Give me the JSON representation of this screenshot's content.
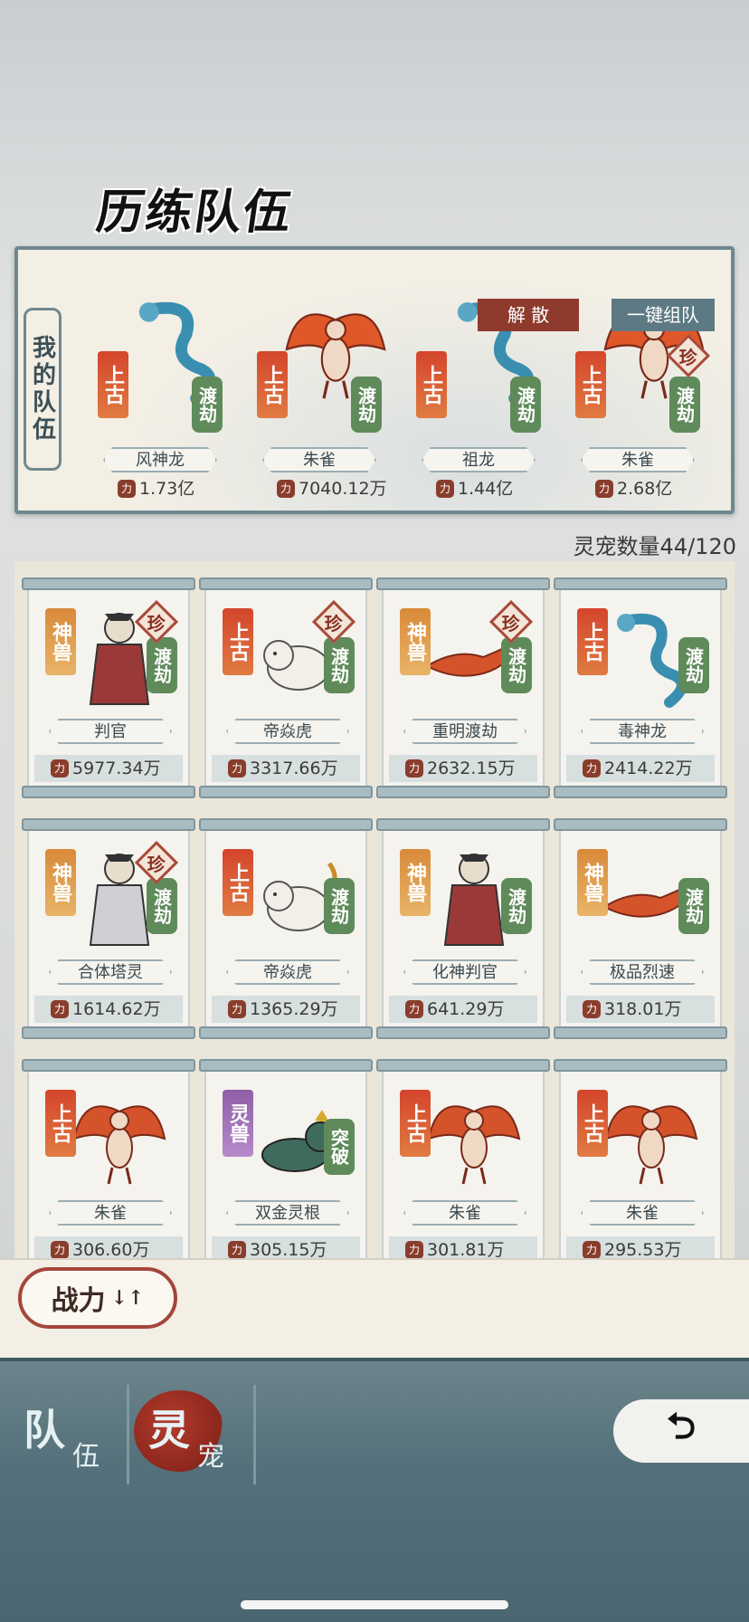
{
  "title": "历练队伍",
  "team_panel": {
    "label": "我的队伍",
    "disband_label": "解 散",
    "one_click_label": "一键组队",
    "members": [
      {
        "name": "风神龙",
        "rank": "上古",
        "stage": "渡劫",
        "rare": "",
        "power": "1.73亿",
        "color": "#3f7a3a"
      },
      {
        "name": "朱雀",
        "rank": "上古",
        "stage": "渡劫",
        "rare": "",
        "power": "7040.12万",
        "color": "#e0572a"
      },
      {
        "name": "祖龙",
        "rank": "上古",
        "stage": "渡劫",
        "rare": "",
        "power": "1.44亿",
        "color": "#3a8fb0"
      },
      {
        "name": "朱雀",
        "rank": "上古",
        "stage": "渡劫",
        "rare": "珍",
        "power": "2.68亿",
        "color": "#e0572a"
      }
    ]
  },
  "pet_count": "灵宠数量44/120",
  "pets": [
    {
      "name": "判官",
      "rank": "神兽",
      "rank_color": "orange",
      "stage": "渡劫",
      "rare": "珍",
      "power": "5977.34万",
      "art": "judge"
    },
    {
      "name": "帝焱虎",
      "rank": "上古",
      "rank_color": "red",
      "stage": "渡劫",
      "rare": "珍",
      "power": "3317.66万",
      "art": "tiger"
    },
    {
      "name": "重明渡劫",
      "rank": "神兽",
      "rank_color": "orange",
      "stage": "渡劫",
      "rare": "珍",
      "power": "2632.15万",
      "art": "bird"
    },
    {
      "name": "毒神龙",
      "rank": "上古",
      "rank_color": "red",
      "stage": "渡劫",
      "rare": "",
      "power": "2414.22万",
      "art": "dragon"
    },
    {
      "name": "合体塔灵",
      "rank": "神兽",
      "rank_color": "orange",
      "stage": "渡劫",
      "rare": "珍",
      "power": "1614.62万",
      "art": "spirit"
    },
    {
      "name": "帝焱虎",
      "rank": "上古",
      "rank_color": "red",
      "stage": "渡劫",
      "rare": "",
      "power": "1365.29万",
      "art": "tiger"
    },
    {
      "name": "化神判官",
      "rank": "神兽",
      "rank_color": "orange",
      "stage": "渡劫",
      "rare": "",
      "power": "641.29万",
      "art": "judge"
    },
    {
      "name": "极品烈速",
      "rank": "神兽",
      "rank_color": "orange",
      "stage": "渡劫",
      "rare": "",
      "power": "318.01万",
      "art": "bird"
    },
    {
      "name": "朱雀",
      "rank": "上古",
      "rank_color": "red",
      "stage": "",
      "rare": "",
      "power": "306.60万",
      "art": "phoenix"
    },
    {
      "name": "双金灵根",
      "rank": "灵兽",
      "rank_color": "purple",
      "stage": "突破",
      "rare": "",
      "power": "305.15万",
      "art": "beast"
    },
    {
      "name": "朱雀",
      "rank": "上古",
      "rank_color": "red",
      "stage": "",
      "rare": "",
      "power": "301.81万",
      "art": "phoenix"
    },
    {
      "name": "朱雀",
      "rank": "上古",
      "rank_color": "red",
      "stage": "",
      "rare": "",
      "power": "295.53万",
      "art": "phoenix"
    }
  ],
  "sort_button": {
    "label": "战力",
    "arrows": "↓↑"
  },
  "nav": {
    "team": {
      "big": "队",
      "small": "伍"
    },
    "pets": {
      "big": "灵",
      "small": "宠"
    },
    "back_icon": "back-arrow-icon"
  },
  "colors": {
    "accent_red": "#a5463a",
    "panel_border": "#6f8890",
    "bottom_bar": "#54707a"
  }
}
